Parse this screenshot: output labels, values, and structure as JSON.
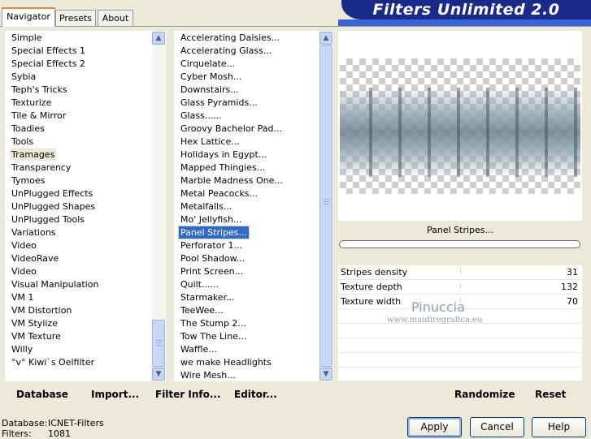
{
  "tabs": [
    "Navigator",
    "Presets",
    "About"
  ],
  "app_title": "Filters Unlimited 2.0",
  "categories": [
    "Simple",
    "Special Effects 1",
    "Special Effects 2",
    "Sybia",
    "Teph's Tricks",
    "Texturize",
    "Tile & Mirror",
    "Toadies",
    "Tools",
    "Tramages",
    "Transparency",
    "Tymoes",
    "UnPlugged Effects",
    "UnPlugged Shapes",
    "UnPlugged Tools",
    "Variations",
    "Video",
    "VideoRave",
    "Video",
    "Visual Manipulation",
    "VM 1",
    "VM Distortion",
    "VM Stylize",
    "VM Texture",
    "Willy",
    "°v° Kiwi`s Oelfilter"
  ],
  "selected_category": "Tramages",
  "filters": [
    "Accelerating Daisies...",
    "Accelerating Glass...",
    "Cirquelate...",
    "Cyber Mosh...",
    "Downstairs...",
    "Glass Pyramids...",
    "Glass......",
    "Groovy Bachelor Pad...",
    "Hex Lattice...",
    "Holidays in Egypt...",
    "Mapped Thingies...",
    "Marble Madness One...",
    "Metal Peacocks...",
    "Metalfalls...",
    "Mo' Jellyfish...",
    "Panel Stripes...",
    "Perforator 1...",
    "Pool Shadow...",
    "Print Screen...",
    "Quilt......",
    "Starmaker...",
    "TeeWee...",
    "The Stump 2...",
    "Tow The Line...",
    "Waffle...",
    "we make Headlights",
    "Wire Mesh..."
  ],
  "selected_filter": "Panel Stripes...",
  "preview_filter_name": "Panel Stripes...",
  "parameters": [
    {
      "label": "Stripes density",
      "value": "31"
    },
    {
      "label": "Texture depth",
      "value": "132"
    },
    {
      "label": "Texture width",
      "value": "70"
    }
  ],
  "watermark": {
    "name": "Pinuccia",
    "url": "www.maidiregrafica.eu"
  },
  "toolbar_left": {
    "database": "Database",
    "import": "Import...",
    "filter_info": "Filter Info...",
    "editor": "Editor..."
  },
  "toolbar_right": {
    "randomize": "Randomize",
    "reset": "Reset"
  },
  "status": {
    "database_label": "Database:",
    "database_value": "ICNET-Filters",
    "filters_label": "Filters:",
    "filters_value": "1081"
  },
  "buttons": {
    "apply": "Apply",
    "cancel": "Cancel",
    "help": "Help"
  },
  "colors": {
    "banner": "#1a2a88",
    "selection": "#316ac5",
    "window": "#ece9d8"
  }
}
